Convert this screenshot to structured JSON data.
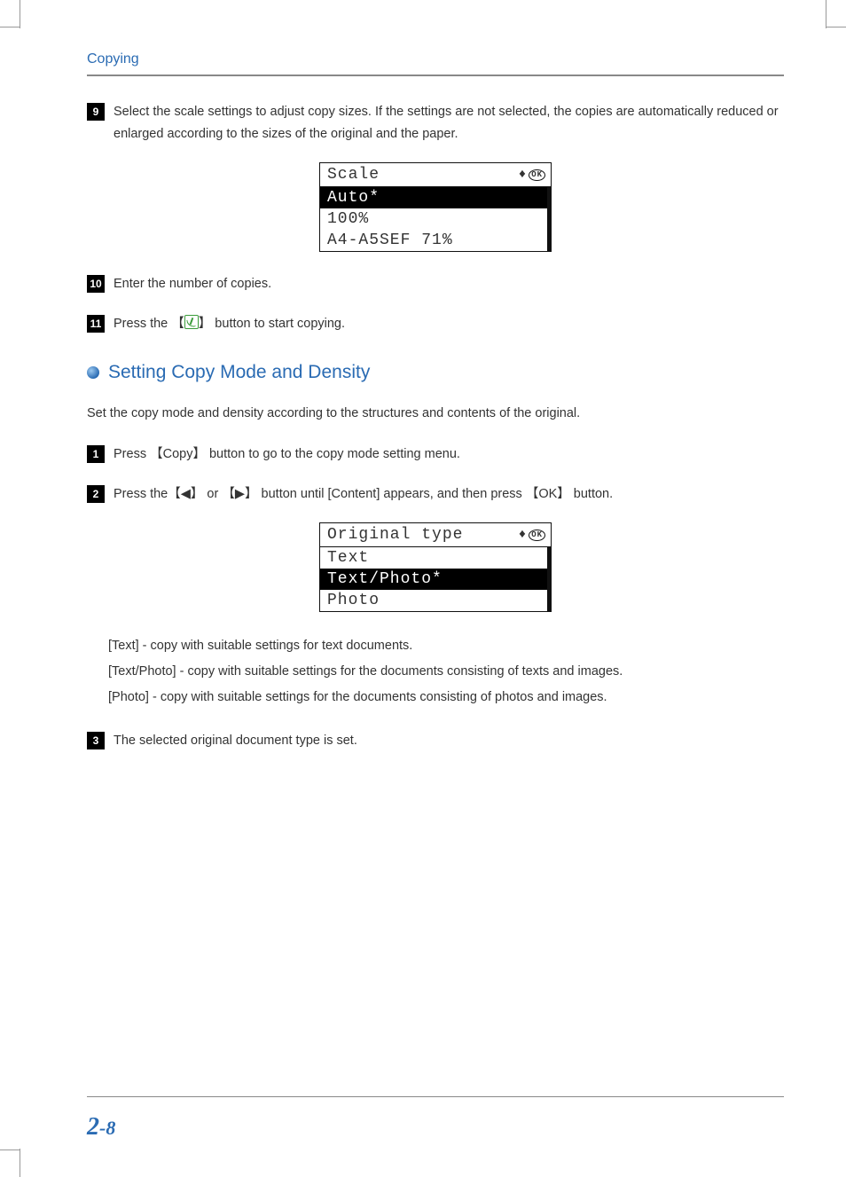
{
  "header": {
    "section": "Copying"
  },
  "steps_top": {
    "s9": {
      "num": "9",
      "text": "Select the scale settings to adjust copy sizes. If the settings are not selected, the copies are automatically reduced or enlarged according to the sizes of the original and the paper."
    },
    "s10": {
      "num": "10",
      "text": "Enter the number of copies."
    },
    "s11": {
      "num": "11",
      "pre": "Press the ",
      "lb": "【",
      "rb": "】",
      "post": " button to start copying."
    }
  },
  "lcd1": {
    "title": "Scale",
    "arrows": "♦",
    "ok": "OK",
    "rows": [
      {
        "label": "Auto*",
        "selected": true
      },
      {
        "label": "100%",
        "selected": false
      },
      {
        "label": "A4-A5SEF 71%",
        "selected": false
      }
    ]
  },
  "subheading": "Setting Copy Mode and Density",
  "intro": "Set the copy mode and density according to the structures and contents of the original.",
  "steps_bottom": {
    "s1": {
      "num": "1",
      "pre": "Press ",
      "lb": "【",
      "copy": "Copy",
      "rb": "】",
      "post": " button to go to the copy mode setting menu."
    },
    "s2": {
      "num": "2",
      "pre": "Press the",
      "lb1": "【",
      "left": "◀",
      "rb1": "】",
      "or": " or ",
      "lb2": "【",
      "right": "▶",
      "rb2": "】",
      "mid": " button until [Content] appears, and then press ",
      "lb3": "【",
      "ok": "OK",
      "rb3": "】",
      "post": " button."
    },
    "s3": {
      "num": "3",
      "text": " The selected original document type is set."
    }
  },
  "lcd2": {
    "title": "Original type",
    "arrows": "♦",
    "ok": "OK",
    "rows": [
      {
        "label": "Text",
        "selected": false
      },
      {
        "label": "Text/Photo*",
        "selected": true
      },
      {
        "label": "Photo",
        "selected": false
      }
    ]
  },
  "definitions": {
    "d1": "[Text] - copy with suitable settings for text documents.",
    "d2": "[Text/Photo] - copy with suitable settings for the documents consisting of texts and images.",
    "d3": "[Photo] - copy with suitable settings for the documents consisting of photos and images."
  },
  "pagenum": {
    "chapter": "2",
    "sep": "-",
    "page": "8"
  }
}
